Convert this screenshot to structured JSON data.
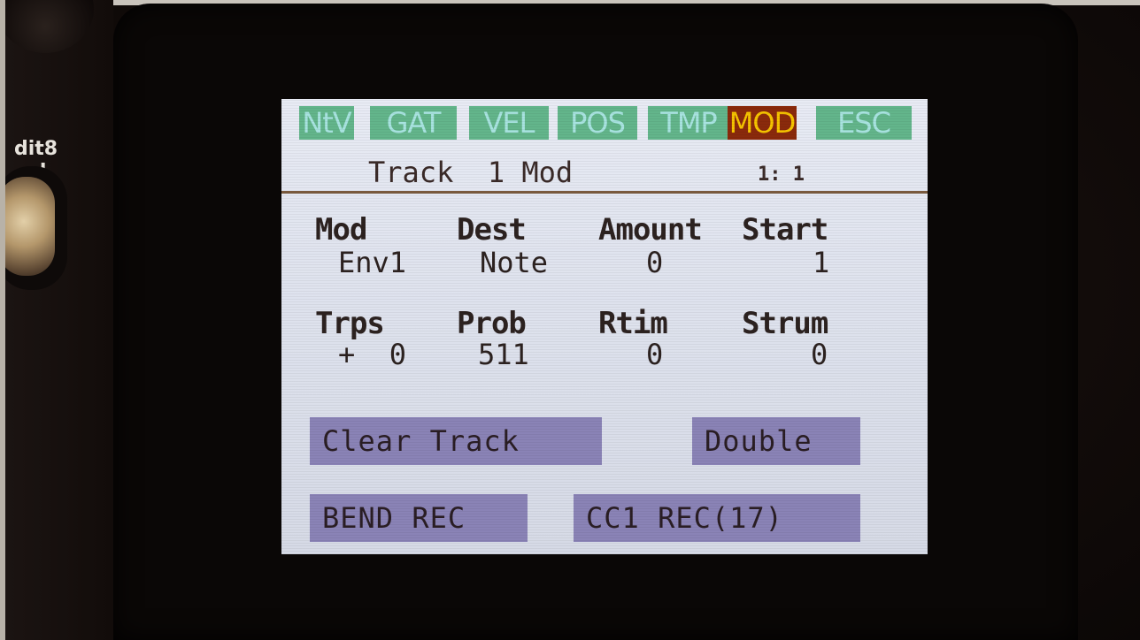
{
  "device": {
    "side_label_line1": "dit8",
    "side_label_line2": "el"
  },
  "tabs": [
    {
      "label": "NtV",
      "active": false
    },
    {
      "label": "GAT",
      "active": false
    },
    {
      "label": "VEL",
      "active": false
    },
    {
      "label": "POS",
      "active": false
    },
    {
      "label": "TMP",
      "active": false
    },
    {
      "label": "MOD",
      "active": true
    },
    {
      "label": "ESC",
      "active": false
    }
  ],
  "header": {
    "title": "Track  1 Mod",
    "position": "1: 1"
  },
  "params_row1": [
    {
      "label": "Mod",
      "value": "Env1"
    },
    {
      "label": "Dest",
      "value": "Note"
    },
    {
      "label": "Amount",
      "value": "0"
    },
    {
      "label": "Start",
      "value": "1"
    }
  ],
  "params_row2": [
    {
      "label": "Trps",
      "value": "+  0"
    },
    {
      "label": "Prob",
      "value": "511"
    },
    {
      "label": "Rtim",
      "value": "0"
    },
    {
      "label": "Strum",
      "value": "0"
    }
  ],
  "buttons": {
    "clear_track": "Clear Track",
    "double": "Double",
    "bend_rec": "BEND REC",
    "cc1_rec": "CC1 REC(17)"
  },
  "colors": {
    "tab_bg": "#63b58b",
    "tab_text": "#a8e3e0",
    "tab_active_bg": "#8a2a0c",
    "tab_active_text": "#f5c400",
    "button_bg": "#8a83b6",
    "screen_bg": "#e3e6f0"
  }
}
